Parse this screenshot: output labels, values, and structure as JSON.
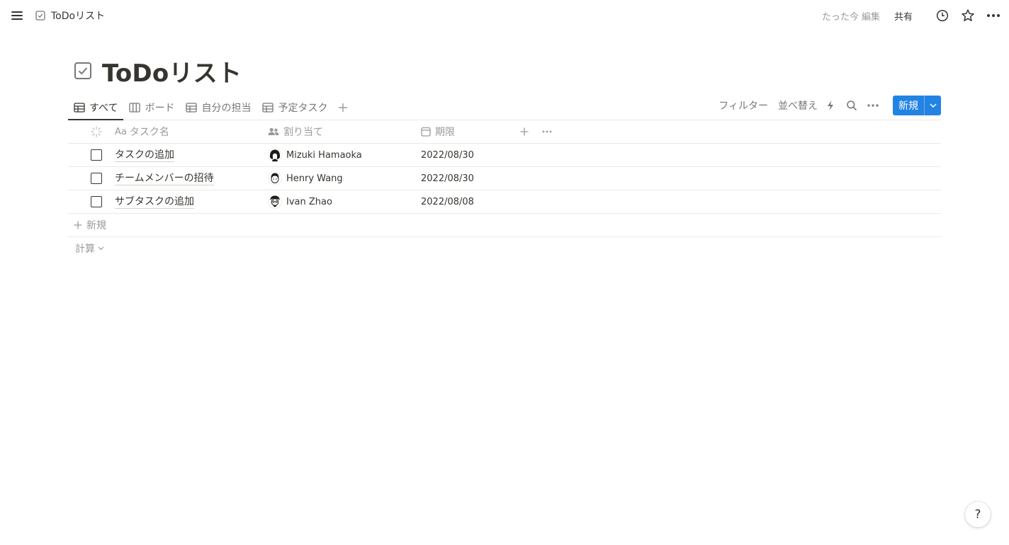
{
  "topbar": {
    "breadcrumb_title": "ToDoリスト",
    "edited": "たった今 編集",
    "share": "共有"
  },
  "page": {
    "title": "ToDoリスト"
  },
  "views": {
    "tabs": [
      {
        "label": "すべて",
        "active": true
      },
      {
        "label": "ボード",
        "active": false
      },
      {
        "label": "自分の担当",
        "active": false
      },
      {
        "label": "予定タスク",
        "active": false
      }
    ],
    "filter": "フィルター",
    "sort": "並べ替え",
    "new_button": "新規"
  },
  "table": {
    "columns": {
      "name": "タスク名",
      "name_prefix": "Aa",
      "assignee": "割り当て",
      "due": "期限"
    },
    "rows": [
      {
        "task": "タスクの追加",
        "assignee": "Mizuki Hamaoka",
        "due": "2022/08/30",
        "done": false
      },
      {
        "task": "チームメンバーの招待",
        "assignee": "Henry Wang",
        "due": "2022/08/30",
        "done": false
      },
      {
        "task": "サブタスクの追加",
        "assignee": "Ivan Zhao",
        "due": "2022/08/08",
        "done": false
      }
    ],
    "new_row": "新規",
    "calculate": "計算"
  },
  "help": "?",
  "colors": {
    "accent": "#2383e2",
    "text": "#37352f",
    "muted": "#9b9a97",
    "divider": "#e9e9e7"
  }
}
